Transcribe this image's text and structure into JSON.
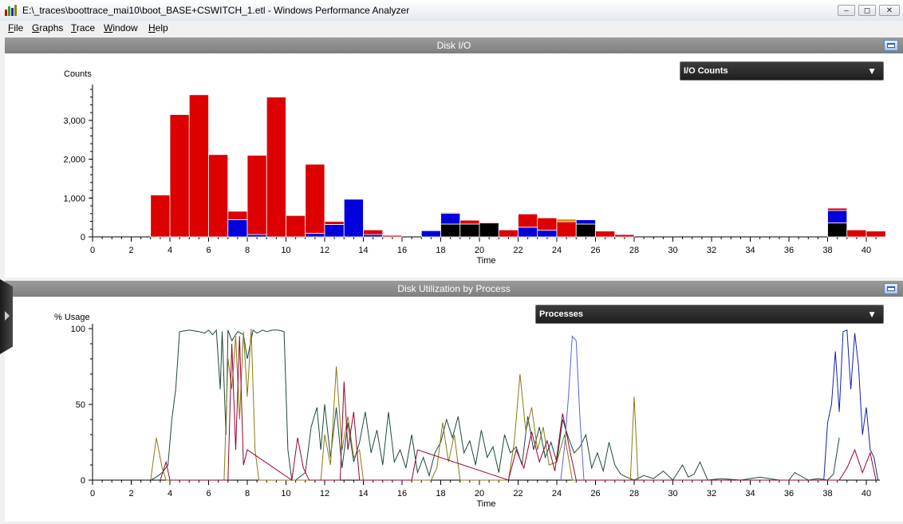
{
  "window": {
    "title": "E:\\_traces\\boottrace_mai10\\boot_BASE+CSWITCH_1.etl - Windows Performance Analyzer",
    "minimize": "‒",
    "restore": "◻",
    "close": "✕"
  },
  "menu": [
    {
      "key": "F",
      "rest": "ile"
    },
    {
      "key": "G",
      "rest": "raphs"
    },
    {
      "key": "T",
      "rest": "race"
    },
    {
      "key": "W",
      "rest": "indow"
    },
    {
      "key": "H",
      "rest": "elp"
    }
  ],
  "disk_io": {
    "header": "Disk I/O",
    "dropdown_value": "I/O Counts",
    "dropdown_arrow": "▼"
  },
  "disk_util": {
    "header": "Disk Utilization by Process",
    "dropdown_value": "Processes",
    "dropdown_arrow": "▼"
  },
  "colors": {
    "red": "#dd0000",
    "blue": "#0000dd",
    "black": "#000000",
    "orange": "#f08c00",
    "dark_green": "#1a4a3a",
    "olive": "#8a7a10",
    "maroon": "#9a0030",
    "light_blue": "#5a60e8",
    "navy": "#1020b0"
  },
  "chart_data": [
    {
      "type": "bar",
      "stacked": true,
      "ylabel": "Counts",
      "xlabel": "Time",
      "xlim": [
        0,
        40.7
      ],
      "ylim": [
        0,
        3800
      ],
      "yticks": [
        0,
        1000,
        2000,
        3000
      ],
      "ytick_labels": [
        "0",
        "1,000",
        "2,000",
        "3,000"
      ],
      "xticks": [
        0,
        2,
        4,
        6,
        8,
        10,
        12,
        14,
        16,
        18,
        20,
        22,
        24,
        26,
        28,
        30,
        32,
        34,
        36,
        38,
        40
      ],
      "bin_width": 1,
      "bins": [
        {
          "x": 3,
          "segments": [
            [
              "red",
              1080
            ]
          ]
        },
        {
          "x": 4,
          "segments": [
            [
              "red",
              3150
            ]
          ]
        },
        {
          "x": 5,
          "segments": [
            [
              "red",
              3660
            ]
          ]
        },
        {
          "x": 6,
          "segments": [
            [
              "red",
              2120
            ]
          ]
        },
        {
          "x": 7,
          "segments": [
            [
              "blue",
              440
            ],
            [
              "red",
              220
            ]
          ]
        },
        {
          "x": 8,
          "segments": [
            [
              "blue",
              60
            ],
            [
              "red",
              2040
            ]
          ]
        },
        {
          "x": 9,
          "segments": [
            [
              "red",
              3600
            ]
          ]
        },
        {
          "x": 10,
          "segments": [
            [
              "red",
              550
            ]
          ]
        },
        {
          "x": 11,
          "segments": [
            [
              "blue",
              90
            ],
            [
              "red",
              1780
            ]
          ]
        },
        {
          "x": 12,
          "segments": [
            [
              "blue",
              320
            ],
            [
              "red",
              80
            ]
          ]
        },
        {
          "x": 13,
          "segments": [
            [
              "blue",
              970
            ]
          ]
        },
        {
          "x": 14,
          "segments": [
            [
              "blue",
              60
            ],
            [
              "red",
              120
            ]
          ]
        },
        {
          "x": 15,
          "segments": [
            [
              "red",
              40
            ]
          ]
        },
        {
          "x": 17,
          "segments": [
            [
              "blue",
              160
            ]
          ]
        },
        {
          "x": 18,
          "segments": [
            [
              "black",
              330
            ],
            [
              "blue",
              280
            ],
            [
              "red",
              20
            ]
          ]
        },
        {
          "x": 19,
          "segments": [
            [
              "black",
              330
            ],
            [
              "red",
              100
            ]
          ]
        },
        {
          "x": 20,
          "segments": [
            [
              "black",
              360
            ],
            [
              "red",
              20
            ]
          ]
        },
        {
          "x": 21,
          "segments": [
            [
              "red",
              180
            ]
          ]
        },
        {
          "x": 22,
          "segments": [
            [
              "blue",
              250
            ],
            [
              "red",
              340
            ]
          ]
        },
        {
          "x": 23,
          "segments": [
            [
              "blue",
              170
            ],
            [
              "red",
              320
            ]
          ]
        },
        {
          "x": 24,
          "segments": [
            [
              "red",
              390
            ],
            [
              "orange",
              70
            ]
          ]
        },
        {
          "x": 25,
          "segments": [
            [
              "black",
              330
            ],
            [
              "blue",
              110
            ]
          ]
        },
        {
          "x": 26,
          "segments": [
            [
              "red",
              150
            ]
          ]
        },
        {
          "x": 27,
          "segments": [
            [
              "red",
              60
            ]
          ]
        },
        {
          "x": 38,
          "segments": [
            [
              "black",
              360
            ],
            [
              "blue",
              320
            ],
            [
              "red",
              60
            ]
          ]
        },
        {
          "x": 39,
          "segments": [
            [
              "red",
              180
            ]
          ]
        },
        {
          "x": 40,
          "segments": [
            [
              "red",
              150
            ]
          ]
        }
      ]
    },
    {
      "type": "line",
      "ylabel": "% Usage",
      "xlabel": "Time",
      "xlim": [
        0,
        40.7
      ],
      "ylim": [
        0,
        100
      ],
      "yticks": [
        0,
        50,
        100
      ],
      "xticks": [
        0,
        2,
        4,
        6,
        8,
        10,
        12,
        14,
        16,
        18,
        20,
        22,
        24,
        26,
        28,
        30,
        32,
        34,
        36,
        38,
        40
      ],
      "series": [
        {
          "color": "dark_green",
          "x": [
            3.0,
            3.3,
            3.6,
            3.9,
            4.1,
            4.3,
            4.5,
            5.0,
            5.5,
            5.8,
            6.0,
            6.2,
            6.4,
            6.6,
            6.7,
            6.9,
            7.0,
            7.2,
            7.5,
            7.8,
            8.0,
            8.3,
            8.5,
            8.8,
            9.0,
            9.3,
            9.6,
            9.9,
            10.1,
            10.3
          ],
          "y": [
            0,
            2,
            5,
            10,
            40,
            60,
            98,
            99,
            98,
            97,
            99,
            96,
            99,
            60,
            98,
            30,
            99,
            92,
            98,
            96,
            80,
            99,
            97,
            99,
            98,
            99,
            99,
            98,
            20,
            0
          ]
        },
        {
          "color": "dark_green",
          "x": [
            10.5,
            11.0,
            11.3,
            11.6,
            11.8,
            12.0,
            12.3,
            12.6,
            12.9,
            13.2,
            13.5,
            13.8,
            14.1,
            14.4,
            14.7,
            15.0,
            15.3,
            15.6,
            15.9,
            16.2,
            16.5,
            16.8,
            17.1,
            17.4,
            17.7,
            18.0,
            18.3,
            18.6,
            18.9,
            19.2,
            19.5,
            19.8,
            20.1,
            20.4,
            20.7,
            21.0,
            21.3,
            21.6,
            21.9,
            22.2,
            22.5,
            22.8,
            23.1,
            23.4,
            23.7,
            24.0,
            24.3,
            24.6,
            24.9,
            25.2,
            25.5,
            25.8,
            26.1,
            26.4,
            26.7,
            27.0,
            27.3,
            27.6,
            28.0,
            28.5,
            29.0,
            29.5,
            30.0,
            30.5,
            30.8,
            31.1,
            31.4,
            31.8,
            32.5,
            33.5,
            34.5,
            35.5,
            36.0,
            36.3,
            37.0,
            37.5,
            38.0,
            38.3,
            38.6
          ],
          "y": [
            0,
            5,
            35,
            48,
            20,
            50,
            15,
            48,
            8,
            38,
            12,
            25,
            45,
            18,
            33,
            10,
            45,
            12,
            20,
            8,
            30,
            5,
            15,
            3,
            18,
            25,
            40,
            28,
            42,
            18,
            26,
            10,
            33,
            15,
            22,
            5,
            30,
            18,
            22,
            10,
            42,
            20,
            35,
            15,
            25,
            12,
            40,
            28,
            18,
            22,
            30,
            8,
            18,
            6,
            25,
            10,
            4,
            2,
            0,
            3,
            1,
            6,
            0,
            10,
            2,
            4,
            12,
            0,
            1,
            0,
            2,
            0,
            0,
            5,
            0,
            1,
            0,
            4,
            28
          ]
        },
        {
          "color": "olive",
          "x": [
            3.0,
            3.3,
            3.6,
            3.8,
            6.8,
            7.0,
            7.2,
            7.4,
            7.6,
            7.8,
            8.0,
            8.2,
            8.4,
            8.6,
            11.8,
            12.0,
            12.3,
            12.6,
            12.9,
            13.2,
            13.5,
            13.8,
            14.0,
            17.5,
            17.8,
            18.1,
            18.4,
            18.7,
            19.0,
            21.5,
            21.8,
            22.1,
            22.4,
            22.7,
            23.0,
            23.3,
            23.6,
            24.0,
            24.4,
            24.8,
            27.8,
            28.0,
            28.2
          ],
          "y": [
            0,
            28,
            8,
            0,
            0,
            80,
            60,
            95,
            40,
            98,
            55,
            100,
            20,
            0,
            0,
            30,
            10,
            75,
            20,
            42,
            15,
            20,
            0,
            0,
            8,
            38,
            12,
            30,
            0,
            0,
            25,
            70,
            32,
            48,
            20,
            35,
            10,
            12,
            30,
            0,
            0,
            55,
            0
          ]
        },
        {
          "color": "maroon",
          "x": [
            3.5,
            3.8,
            4.0,
            7.0,
            7.2,
            7.4,
            7.6,
            7.8,
            8.0,
            10.3,
            10.6,
            10.9,
            11.2,
            12.8,
            13.0,
            13.2,
            13.5,
            13.8,
            16.5,
            16.8,
            21.5,
            21.9,
            22.3,
            22.7,
            23.1,
            23.5,
            23.9,
            24.3,
            24.7,
            25.0,
            38.6,
            39.0,
            39.4,
            39.8,
            40.2,
            40.5
          ],
          "y": [
            0,
            12,
            0,
            0,
            90,
            20,
            95,
            10,
            20,
            0,
            28,
            8,
            0,
            0,
            65,
            20,
            45,
            0,
            0,
            20,
            0,
            20,
            8,
            32,
            12,
            26,
            6,
            44,
            18,
            0,
            0,
            8,
            20,
            5,
            18,
            0
          ]
        },
        {
          "color": "light_blue",
          "x": [
            24.2,
            24.4,
            24.6,
            24.8,
            25.0,
            25.2,
            25.4
          ],
          "y": [
            0,
            22,
            55,
            95,
            92,
            40,
            0
          ]
        },
        {
          "color": "navy",
          "x": [
            37.8,
            38.0,
            38.2,
            38.4,
            38.6,
            38.8,
            39.0,
            39.2,
            39.4,
            39.6,
            39.8,
            40.0,
            40.2,
            40.4,
            40.6
          ],
          "y": [
            0,
            38,
            50,
            85,
            45,
            98,
            99,
            60,
            97,
            75,
            30,
            48,
            20,
            15,
            0
          ]
        }
      ]
    }
  ]
}
